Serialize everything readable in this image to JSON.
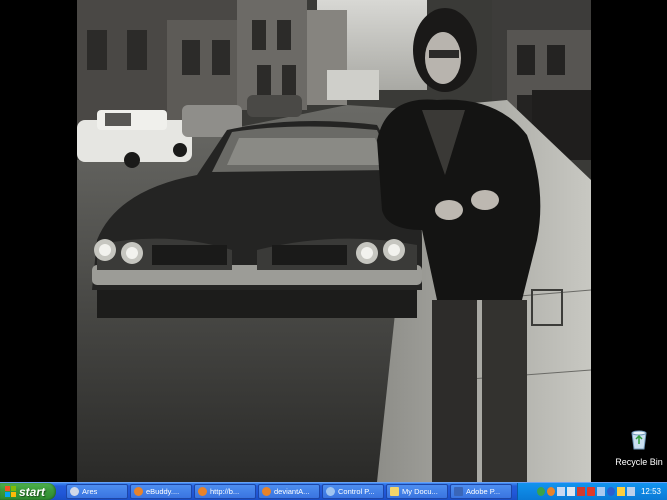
{
  "desktop": {
    "recycle_bin_label": "Recycle Bin"
  },
  "taskbar": {
    "start_label": "start",
    "tasks": [
      {
        "label": "Ares",
        "icon": "ares-icon",
        "color": "#d0d8e8"
      },
      {
        "label": "eBuddy....",
        "icon": "firefox-icon",
        "color": "#e8832a"
      },
      {
        "label": "http://b...",
        "icon": "firefox-icon",
        "color": "#e8832a"
      },
      {
        "label": "deviantA...",
        "icon": "firefox-icon",
        "color": "#e8832a"
      },
      {
        "label": "Control P...",
        "icon": "control-panel-icon",
        "color": "#9fc4f0"
      },
      {
        "label": "My Docu...",
        "icon": "folder-icon",
        "color": "#f3d46a"
      },
      {
        "label": "Adobe P...",
        "icon": "photoshop-icon",
        "color": "#3a66b8"
      }
    ],
    "clock": "12:53"
  },
  "colors": {
    "taskbar": "#245edb",
    "start": "#3c9c3c",
    "tray": "#0f8be6"
  }
}
